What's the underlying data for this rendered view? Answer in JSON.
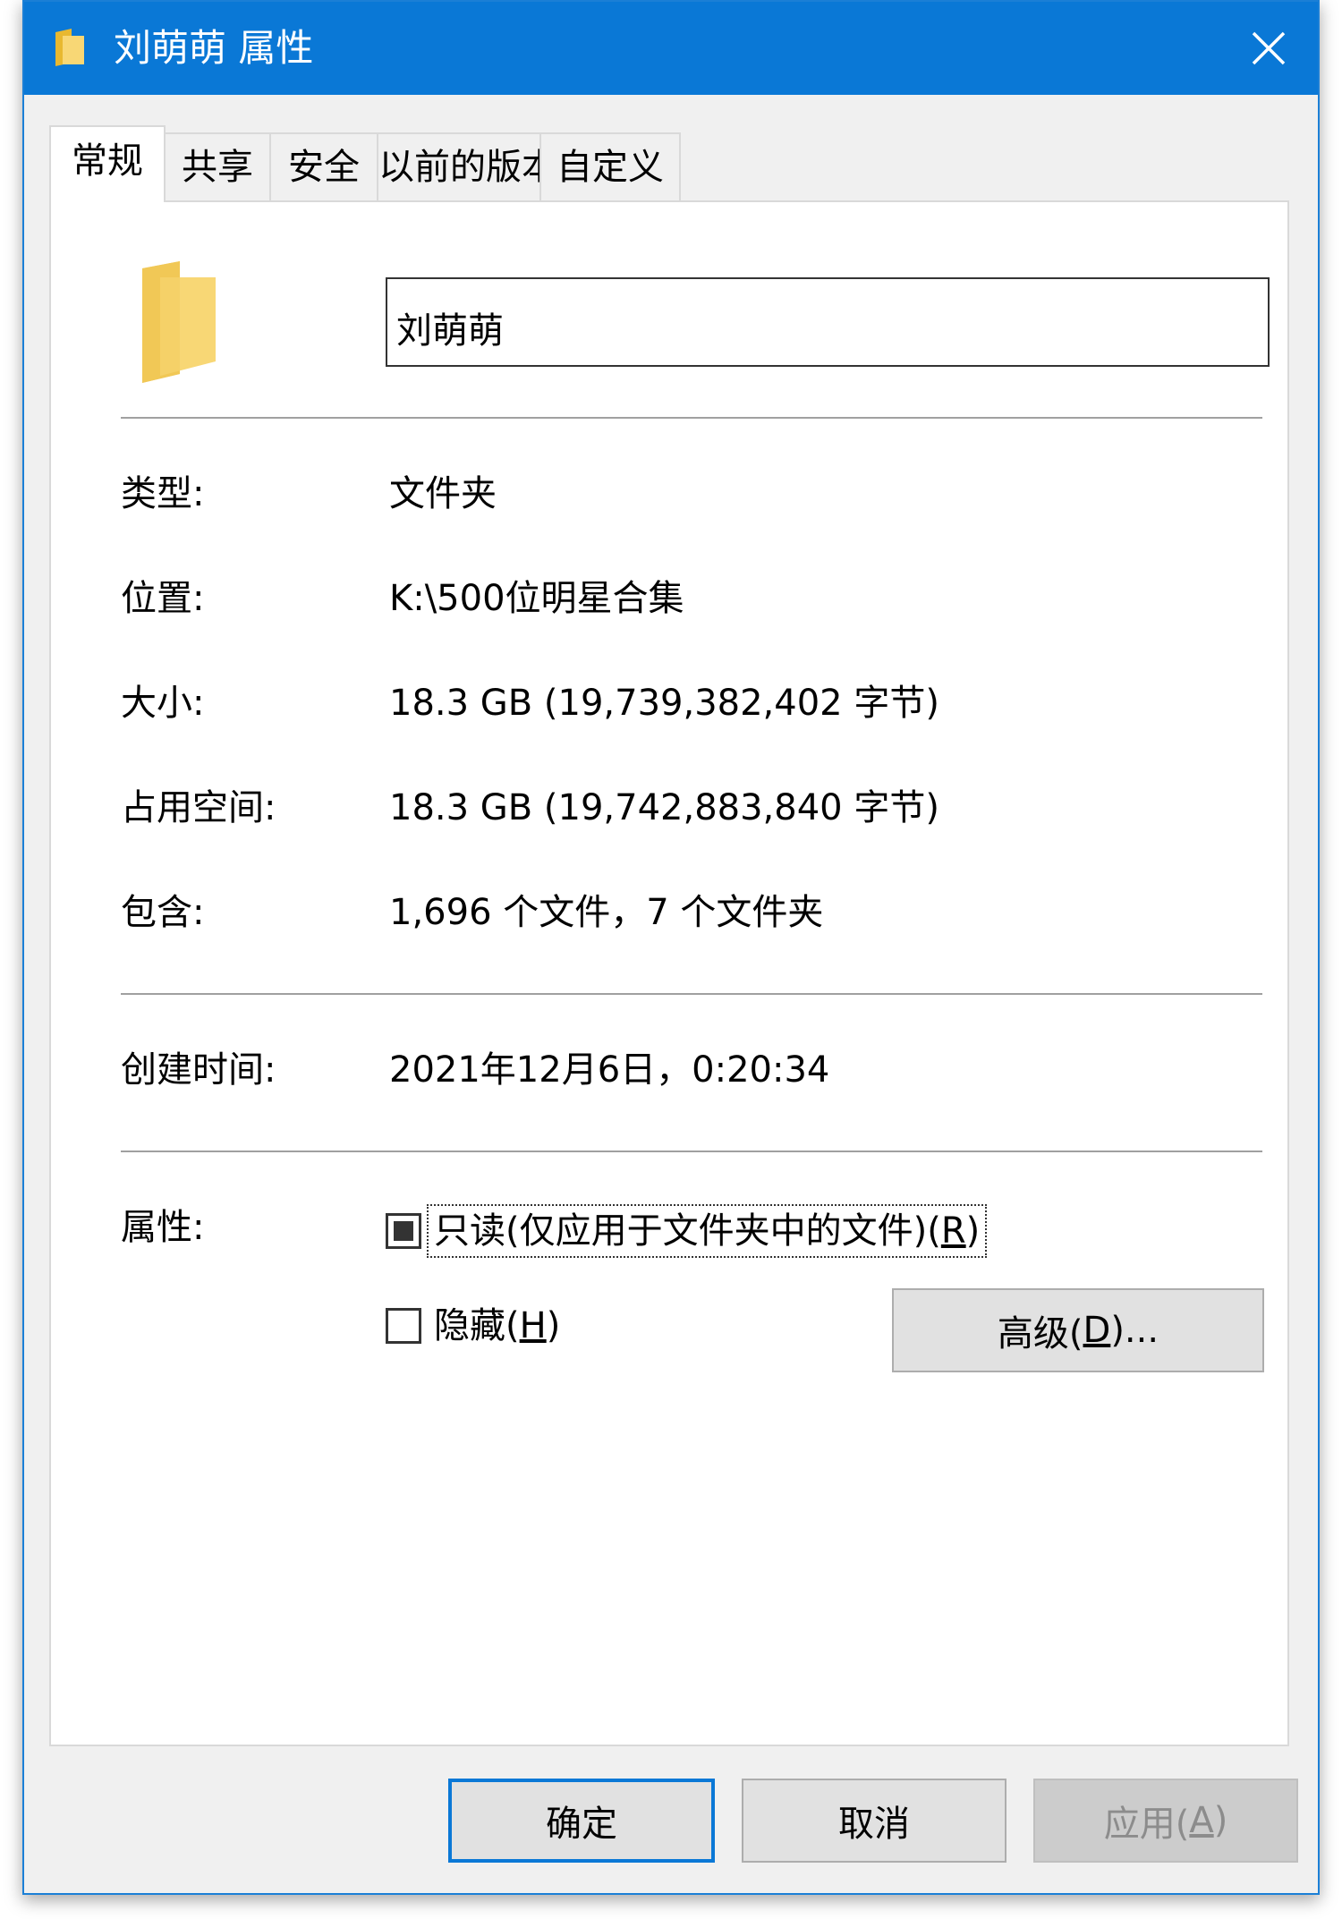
{
  "window": {
    "title": "刘萌萌 属性",
    "close_icon": "close-icon"
  },
  "tabs": [
    {
      "label": "常规",
      "active": true
    },
    {
      "label": "共享",
      "active": false
    },
    {
      "label": "安全",
      "active": false
    },
    {
      "label": "以前的版本",
      "active": false
    },
    {
      "label": "自定义",
      "active": false
    }
  ],
  "general": {
    "folder_icon": "folder-icon",
    "name_value": "刘萌萌",
    "rows": [
      {
        "label": "类型:",
        "value": "文件夹"
      },
      {
        "label": "位置:",
        "value": "K:\\500位明星合集"
      },
      {
        "label": "大小:",
        "value": "18.3 GB (19,739,382,402 字节)"
      },
      {
        "label": "占用空间:",
        "value": "18.3 GB (19,742,883,840 字节)"
      },
      {
        "label": "包含:",
        "value": "1,696 个文件，7 个文件夹"
      }
    ],
    "created": {
      "label": "创建时间:",
      "value": "2021年12月6日，0:20:34"
    },
    "attributes": {
      "label": "属性:",
      "readonly": {
        "prefix": "只读(仅应用于文件夹中的文件)(",
        "key": "R",
        "suffix": ")",
        "state": "indeterminate"
      },
      "hidden": {
        "prefix": "隐藏(",
        "key": "H",
        "suffix": ")",
        "checked": false
      },
      "advanced": {
        "prefix": "高级(",
        "key": "D",
        "suffix": ")..."
      }
    }
  },
  "buttons": {
    "ok": "确定",
    "cancel": "取消",
    "apply": {
      "prefix": "应用(",
      "key": "A",
      "suffix": ")",
      "disabled": true
    }
  },
  "colors": {
    "titlebar": "#0a78d6",
    "folder_yellow": "#f8d775",
    "focus_border": "#0a78d6"
  }
}
